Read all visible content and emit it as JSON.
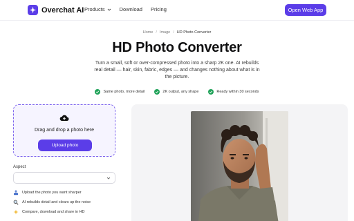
{
  "header": {
    "logo_text": "Overchat AI",
    "nav": [
      {
        "label": "Products",
        "has_dropdown": true
      },
      {
        "label": "Download",
        "has_dropdown": false
      },
      {
        "label": "Pricing",
        "has_dropdown": false
      }
    ],
    "cta_label": "Open Web App",
    "brand_color": "#5b3de8"
  },
  "breadcrumb": [
    "Home",
    "Image",
    "HD Photo Converter"
  ],
  "title": "HD Photo Converter",
  "description": "Turn a small, soft or over-compressed photo into a sharp 2K one. AI rebuilds real detail — hair, skin, fabric, edges — and changes nothing about what is in the picture.",
  "features": [
    {
      "label": "Same photo, more detail",
      "icon": "check-icon"
    },
    {
      "label": "2K output, any shape",
      "icon": "check-icon"
    },
    {
      "label": "Ready within 30 seconds",
      "icon": "check-icon"
    }
  ],
  "upload": {
    "prompt": "Drag and drop a photo here",
    "button_label": "Upload photo",
    "icon": "cloud-upload-icon"
  },
  "aspect": {
    "label": "Aspect",
    "value": ""
  },
  "steps": [
    {
      "icon": "upload-icon",
      "text": "Upload the photo you want sharper"
    },
    {
      "icon": "magnifier-icon",
      "text": "AI rebuilds detail and clears up the noise"
    },
    {
      "icon": "sparkle-icon",
      "text": "Compare, download and share in HD"
    }
  ]
}
